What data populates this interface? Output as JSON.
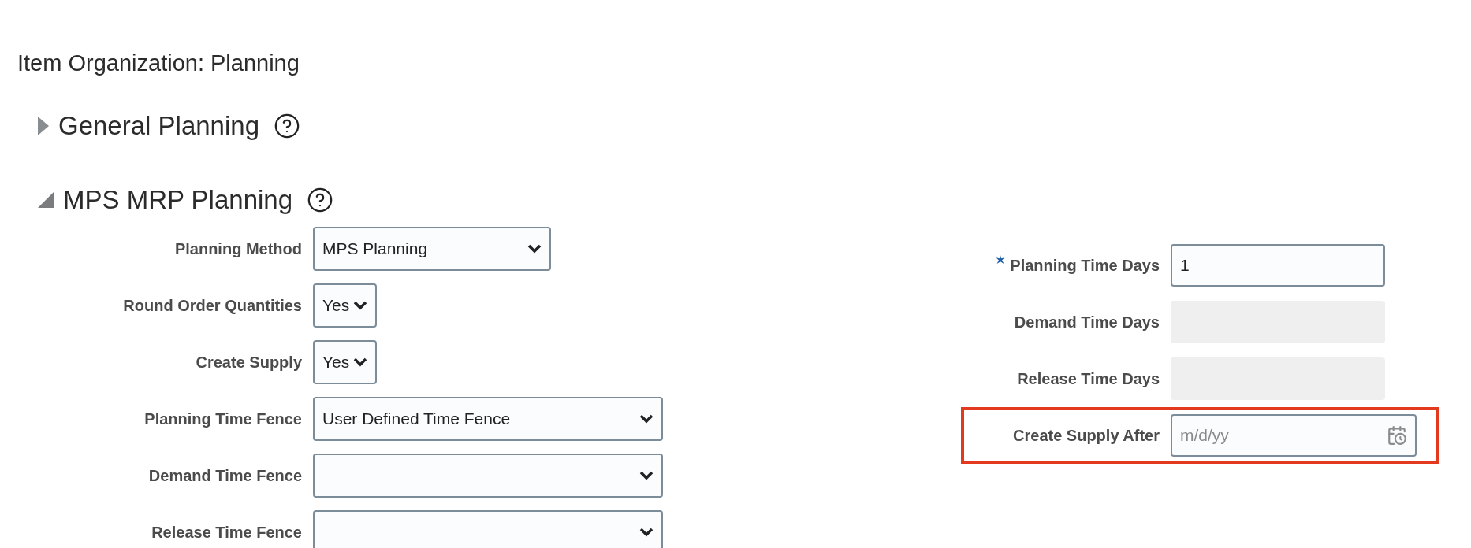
{
  "page_title": "Item Organization: Planning",
  "sections": [
    {
      "title": "General Planning",
      "expanded": false
    },
    {
      "title": "MPS MRP Planning",
      "expanded": true,
      "left_fields": [
        {
          "kind": "select",
          "label": "Planning Method",
          "value": "MPS Planning"
        },
        {
          "kind": "select",
          "label": "Round Order Quantities",
          "value": "Yes"
        },
        {
          "kind": "select",
          "label": "Create Supply",
          "value": "Yes"
        },
        {
          "kind": "select",
          "label": "Planning Time Fence",
          "value": "User Defined Time Fence"
        },
        {
          "kind": "select",
          "label": "Demand Time Fence"
        },
        {
          "kind": "select",
          "label": "Release Time Fence"
        }
      ],
      "right_fields": [
        {
          "kind": "input",
          "label": "Planning Time Days",
          "value": "1",
          "required": true,
          "highlighted": false
        },
        {
          "kind": "readonly",
          "label": "Demand Time Days",
          "required": false,
          "highlighted": false
        },
        {
          "kind": "readonly",
          "label": "Release Time Days",
          "required": false,
          "highlighted": false
        },
        {
          "kind": "date",
          "label": "Create Supply After",
          "placeholder": "m/d/yy",
          "required": false,
          "highlighted": true
        }
      ]
    }
  ]
}
